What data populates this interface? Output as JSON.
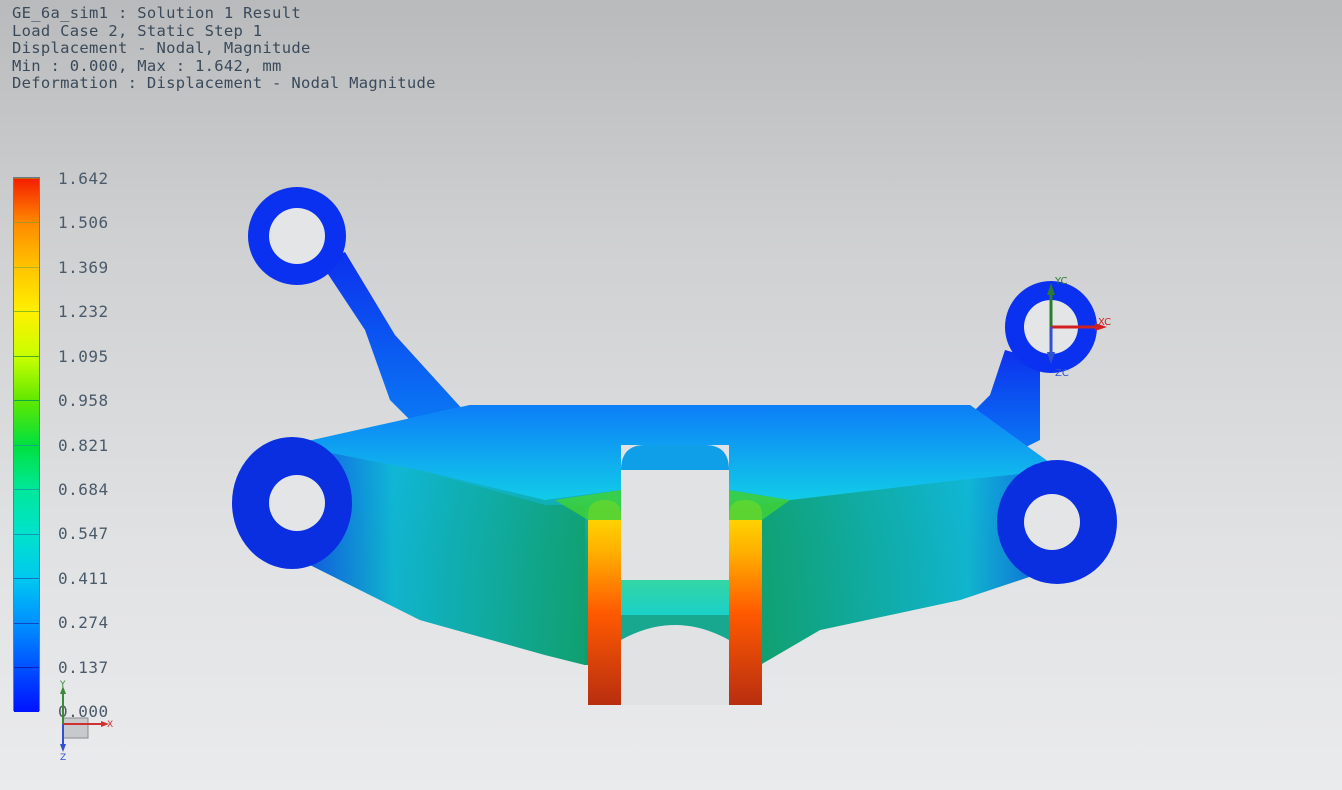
{
  "header": {
    "line1": "GE_6a_sim1 : Solution 1 Result",
    "line2": "Load Case 2, Static Step 1",
    "line3": "Displacement - Nodal, Magnitude",
    "line4": "Min : 0.000, Max : 1.642, mm",
    "line5": "Deformation : Displacement - Nodal Magnitude"
  },
  "legend": {
    "labels": [
      "1.642",
      "1.506",
      "1.369",
      "1.232",
      "1.095",
      "0.958",
      "0.821",
      "0.684",
      "0.547",
      "0.411",
      "0.274",
      "0.137",
      "0.000"
    ],
    "colors": [
      "#f51f00",
      "#ff8a00",
      "#ffc400",
      "#fff000",
      "#c8ff00",
      "#5fe800",
      "#00e040",
      "#00e89a",
      "#00e2cc",
      "#00c8f0",
      "#0090ff",
      "#0050ff",
      "#0012ff"
    ]
  },
  "wcs": {
    "x_label": "XC",
    "y_label": "YC",
    "z_label": "ZC"
  },
  "triad": {
    "x_label": "X",
    "y_label": "Y",
    "z_label": "Z"
  },
  "colors": {
    "part_blue": "#0b2fe6",
    "part_cyan": "#10c8e8",
    "part_green": "#10a070",
    "max_red": "#d63010",
    "header_text": "#3a4a5a"
  }
}
